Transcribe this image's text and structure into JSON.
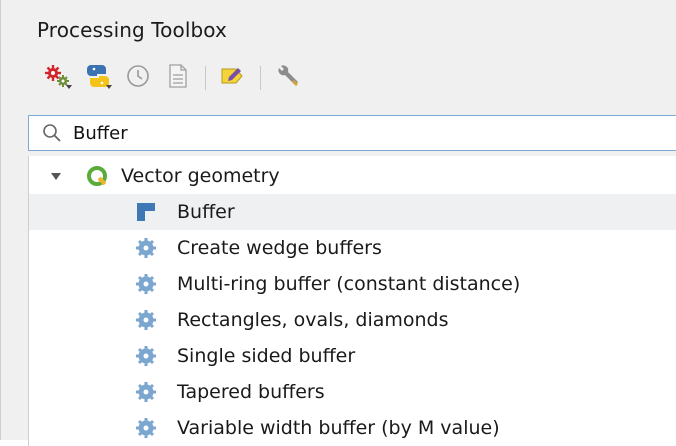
{
  "panel": {
    "title": "Processing Toolbox"
  },
  "toolbar": {
    "buttons": [
      {
        "icon": "models-gear-icon",
        "has_dropdown": true
      },
      {
        "icon": "python-scripts-icon",
        "has_dropdown": true
      },
      {
        "icon": "history-clock-icon",
        "has_dropdown": false
      },
      {
        "icon": "results-document-icon",
        "has_dropdown": false
      },
      {
        "icon": "edit-in-place-icon",
        "has_dropdown": false
      },
      {
        "icon": "options-wrench-icon",
        "has_dropdown": false
      }
    ]
  },
  "search": {
    "value": "Buffer",
    "icon": "search-icon"
  },
  "tree": {
    "group": {
      "label": "Vector geometry",
      "expanded": true,
      "icon": "qgis-logo-icon"
    },
    "items": [
      {
        "label": "Buffer",
        "icon": "buffer-tool-icon",
        "selected": true
      },
      {
        "label": "Create wedge buffers",
        "icon": "algorithm-gear-icon"
      },
      {
        "label": "Multi-ring buffer (constant distance)",
        "icon": "algorithm-gear-icon"
      },
      {
        "label": "Rectangles, ovals, diamonds",
        "icon": "algorithm-gear-icon"
      },
      {
        "label": "Single sided buffer",
        "icon": "algorithm-gear-icon"
      },
      {
        "label": "Tapered buffers",
        "icon": "algorithm-gear-icon"
      },
      {
        "label": "Variable width buffer (by M value)",
        "icon": "algorithm-gear-icon"
      }
    ]
  },
  "colors": {
    "selection": "#eef0f2",
    "search_border": "#7fa7d6",
    "qgis_green": "#5aab3a"
  }
}
